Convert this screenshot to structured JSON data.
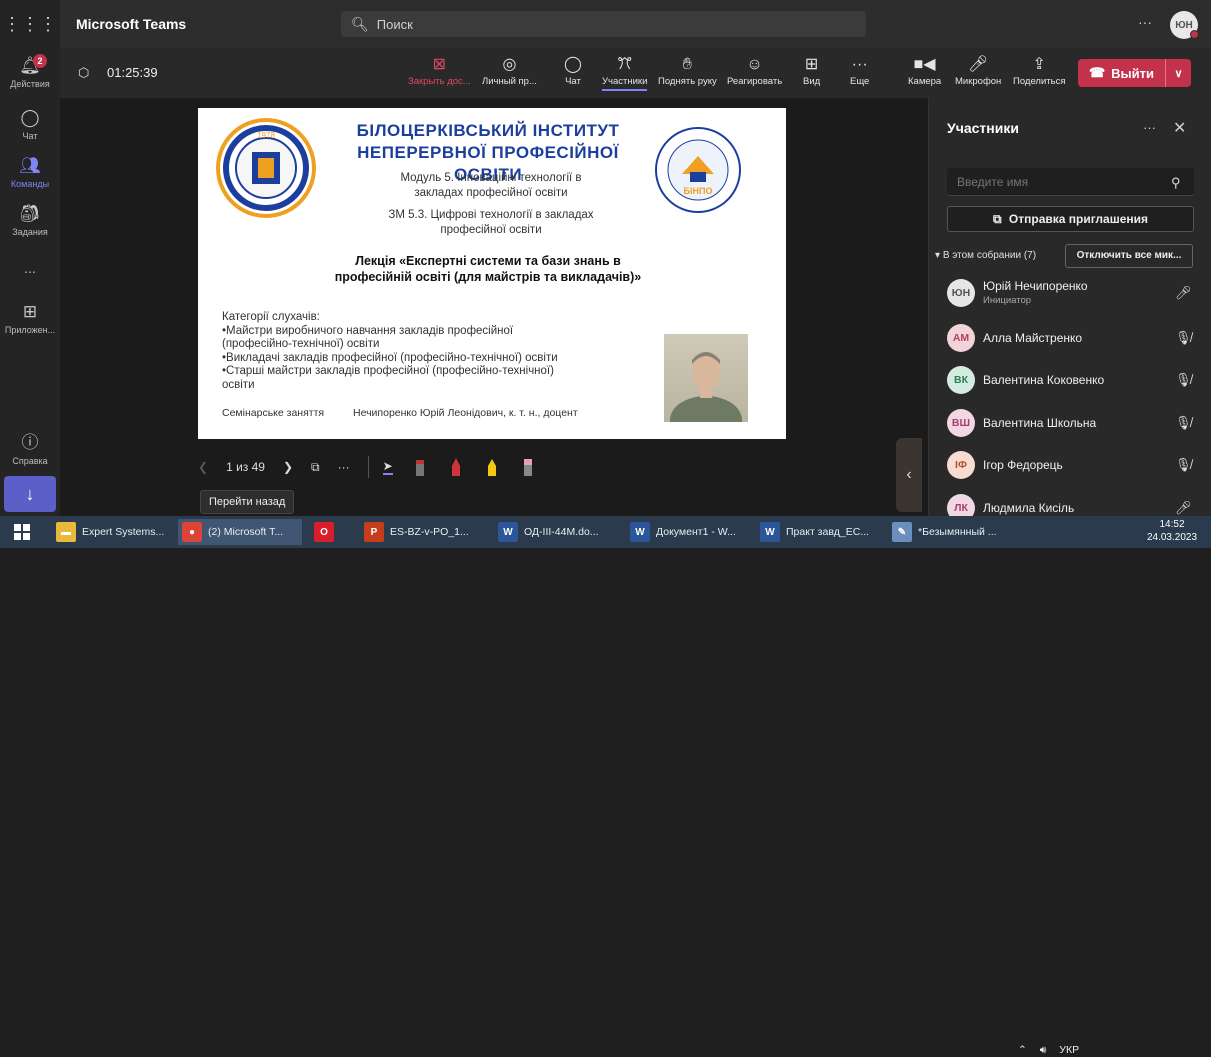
{
  "app": {
    "title": "Microsoft Teams",
    "user_initials": "ЮН"
  },
  "search": {
    "placeholder": "Поиск"
  },
  "rail": {
    "activity_label": "Действия",
    "activity_badge": "2",
    "chat_label": "Чат",
    "teams_label": "Команды",
    "assignments_label": "Задания",
    "more_label": "...",
    "apps_label": "Приложен...",
    "help_label": "Справка"
  },
  "meeting": {
    "timer": "01:25:39",
    "toolbar": [
      {
        "label": "Закрыть дос...",
        "icon": "close-share-icon"
      },
      {
        "label": "Личный пр...",
        "icon": "eye-icon"
      },
      {
        "label": "Чат",
        "icon": "chat-icon"
      },
      {
        "label": "Участники",
        "icon": "people-icon"
      },
      {
        "label": "Поднять руку",
        "icon": "raise-hand-icon"
      },
      {
        "label": "Реагировать",
        "icon": "smile-icon"
      },
      {
        "label": "Вид",
        "icon": "grid-icon"
      },
      {
        "label": "Еще",
        "icon": "more-icon"
      },
      {
        "label": "Камера",
        "icon": "camera-icon"
      },
      {
        "label": "Микрофон",
        "icon": "mic-icon"
      },
      {
        "label": "Поделиться",
        "icon": "share-icon"
      }
    ],
    "leave_label": "Выйти"
  },
  "slide": {
    "institute_line1": "БІЛОЦЕРКІВСЬКИЙ ІНСТИТУТ",
    "institute_line2": "НЕПЕРЕРВНОЇ ПРОФЕСІЙНОЇ ОСВІТИ",
    "module_line1": "Модуль 5. Інноваційні технології в",
    "module_line2": "закладах професійної освіти",
    "zm_line1": "ЗМ 5.3. Цифрові технології в закладах",
    "zm_line2": "професійної освіти",
    "lecture_line1": "Лекція «Експертні системи та бази знань в",
    "lecture_line2": "професійній освіті (для майстрів та викладачів)»",
    "categories_title": "Категорії слухачів:",
    "categories": [
      "•Майстри виробничого навчання закладів професійної",
      "(професійно-технічної) освіти",
      "•Викладачі закладів професійної (професійно-технічної) освіти",
      "•Старші майстри закладів професійної (професійно-технічної)",
      "освіти"
    ],
    "footer_left": "Семінарське заняття",
    "footer_right": "Нечипоренко Юрій Леонідович, к. т. н., доцент",
    "logo_right_text": "БІНПО",
    "logo_left_year": "1978"
  },
  "slide_controls": {
    "page": "1 из 49",
    "tooltip": "Перейти назад"
  },
  "panel": {
    "title": "Участники",
    "name_placeholder": "Введите имя",
    "invite_label": "Отправка приглашения",
    "in_meeting_label": "В этом собрании (7)",
    "mute_all_label": "Отключить все мик...",
    "participants": [
      {
        "initials": "ЮН",
        "name": "Юрій Нечипоренко",
        "role": "Инициатор",
        "mic": "on",
        "avatar_bg": "#e6e6e6",
        "avatar_fg": "#555555"
      },
      {
        "initials": "АМ",
        "name": "Алла Майстренко",
        "role": "",
        "mic": "off",
        "avatar_bg": "#f3d3da",
        "avatar_fg": "#b4415a"
      },
      {
        "initials": "ВК",
        "name": "Валентина Коковенко",
        "role": "",
        "mic": "off",
        "avatar_bg": "#d4ece0",
        "avatar_fg": "#2f7d55"
      },
      {
        "initials": "ВШ",
        "name": "Валентина Школьна",
        "role": "",
        "mic": "off",
        "avatar_bg": "#f1d6e3",
        "avatar_fg": "#a8406f"
      },
      {
        "initials": "ІФ",
        "name": "Ігор Федорець",
        "role": "",
        "mic": "off",
        "avatar_bg": "#f7dcd2",
        "avatar_fg": "#b5502c"
      },
      {
        "initials": "ЛК",
        "name": "Людмила Кисіль",
        "role": "",
        "mic": "on",
        "avatar_bg": "#f1d6e3",
        "avatar_fg": "#a8406f"
      }
    ]
  },
  "taskbar": {
    "items": [
      {
        "label": "Expert Systems...",
        "icon": "folder-icon",
        "color": "#e8b93a"
      },
      {
        "label": "(2) Microsoft T...",
        "icon": "chrome-icon",
        "color": "#db4437"
      },
      {
        "label": "",
        "icon": "opera-icon",
        "color": "#d91e2a"
      },
      {
        "label": "ES-BZ-v-PO_1...",
        "icon": "powerpoint-icon",
        "color": "#c43e1c"
      },
      {
        "label": "ОД-III-44M.do...",
        "icon": "word-icon",
        "color": "#2b579a"
      },
      {
        "label": "Документ1 - W...",
        "icon": "word-icon",
        "color": "#2b579a"
      },
      {
        "label": "Практ завд_ЕС...",
        "icon": "word-icon",
        "color": "#2b579a"
      },
      {
        "label": "*Безымянный ...",
        "icon": "paint-icon",
        "color": "#6a8fbf"
      }
    ],
    "tray_lang": "УКР",
    "time": "14:52",
    "date": "24.03.2023"
  }
}
